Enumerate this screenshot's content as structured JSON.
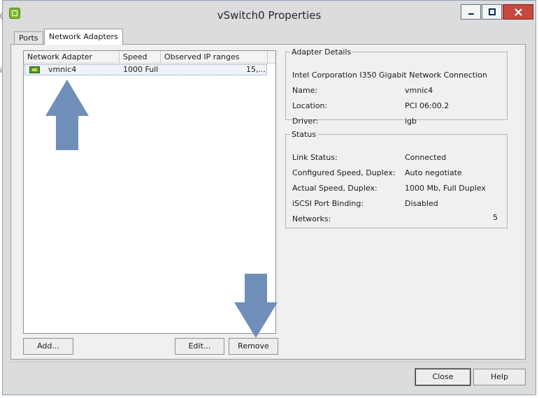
{
  "window": {
    "title": "vSwitch0 Properties"
  },
  "background_edge": {
    "glyph_1": "(",
    "glyph_2": "i"
  },
  "tabs": [
    {
      "label": "Ports"
    },
    {
      "label": "Network Adapters"
    }
  ],
  "adapter_list": {
    "columns": [
      "Network Adapter",
      "Speed",
      "Observed IP ranges"
    ],
    "rows": [
      {
        "name": "vmnic4",
        "speed": "1000 Full",
        "ip_ranges": "15,..."
      }
    ]
  },
  "list_buttons": {
    "add": "Add...",
    "edit": "Edit...",
    "remove": "Remove"
  },
  "adapter_details": {
    "legend": "Adapter Details",
    "description": "Intel Corporation I350 Gigabit Network Connection",
    "name_label": "Name:",
    "name_value": "vmnic4",
    "location_label": "Location:",
    "location_value": "PCI 06:00.2",
    "driver_label": "Driver:",
    "driver_value": "igb"
  },
  "status": {
    "legend": "Status",
    "link_status_label": "Link Status:",
    "link_status_value": "Connected",
    "configured_speed_label": "Configured Speed, Duplex:",
    "configured_speed_value": "Auto negotiate",
    "actual_speed_label": "Actual Speed, Duplex:",
    "actual_speed_value": "1000 Mb, Full Duplex",
    "iscsi_label": "iSCSI Port Binding:",
    "iscsi_value": "Disabled",
    "networks_label": "Networks:",
    "networks_value": "5"
  },
  "dialog_buttons": {
    "close": "Close",
    "help": "Help"
  },
  "icons": {
    "app": "vsphere-client-icon",
    "nic": "network-adapter-icon",
    "annotation_up": "arrow-up-icon",
    "annotation_down": "arrow-down-icon"
  },
  "colors": {
    "annotation_arrow": "#6f8fb8",
    "close_button": "#c7483e"
  }
}
